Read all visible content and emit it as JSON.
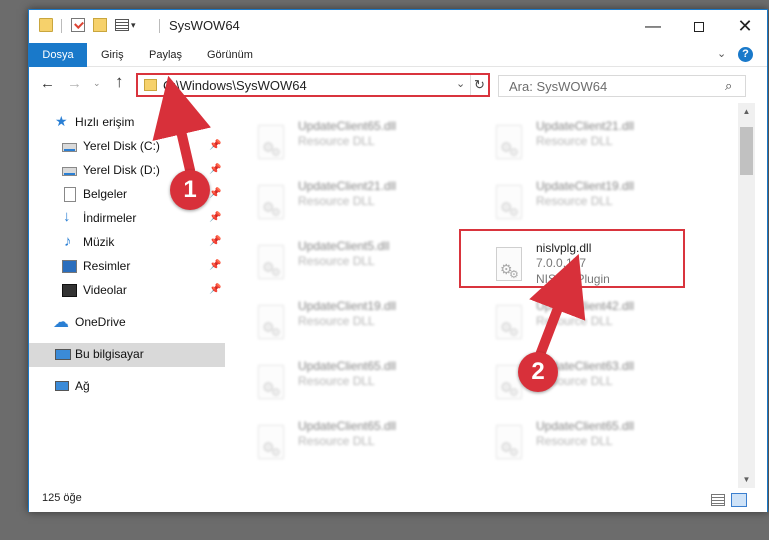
{
  "window": {
    "title": "SysWOW64",
    "minimize_glyph": "—",
    "close_glyph": "✕"
  },
  "quick_access_toolbar": {
    "dropdown_glyph": "▾",
    "pin_glyph": "▾"
  },
  "ribbon": {
    "tabs": [
      "Dosya",
      "Giriş",
      "Paylaş",
      "Görünüm"
    ],
    "collapse_glyph": "⌄",
    "help_glyph": "?"
  },
  "navigation": {
    "back_glyph": "←",
    "forward_glyph": "→",
    "recent_glyph": "⌄",
    "up_glyph": "↑",
    "address": "C:\\Windows\\SysWOW64",
    "address_dropdown_glyph": "⌄",
    "refresh_glyph": "↻",
    "search_placeholder": "Ara: SysWOW64",
    "search_glyph": "⌕"
  },
  "sidebar": {
    "items": [
      {
        "label": "Hızlı erişim",
        "icon": "star-icon",
        "glyph": "★",
        "pinned": false
      },
      {
        "label": "Yerel Disk (C:)",
        "icon": "drive-icon",
        "pinned": true
      },
      {
        "label": "Yerel Disk (D:)",
        "icon": "drive-icon",
        "pinned": true
      },
      {
        "label": "Belgeler",
        "icon": "document-icon",
        "pinned": true
      },
      {
        "label": "İndirmeler",
        "icon": "download-icon",
        "glyph": "↓",
        "pinned": true
      },
      {
        "label": "Müzik",
        "icon": "music-icon",
        "glyph": "♪",
        "pinned": true
      },
      {
        "label": "Resimler",
        "icon": "pictures-icon",
        "pinned": true
      },
      {
        "label": "Videolar",
        "icon": "videos-icon",
        "pinned": true
      },
      {
        "label": "OneDrive",
        "icon": "cloud-icon",
        "glyph": "☁",
        "pinned": false
      },
      {
        "label": "Bu bilgisayar",
        "icon": "computer-icon",
        "pinned": false,
        "selected": true
      },
      {
        "label": "Ağ",
        "icon": "network-icon",
        "pinned": false
      }
    ],
    "pin_glyph": "📌"
  },
  "files": [
    {
      "name": "UpdateClient65.dll",
      "line2": "Resource DLL",
      "line3": "",
      "blurred": true
    },
    {
      "name": "UpdateClient21.dll",
      "line2": "Resource DLL",
      "line3": "",
      "blurred": true
    },
    {
      "name": "UpdateClient21.dll",
      "line2": "Resource DLL",
      "line3": "",
      "blurred": true
    },
    {
      "name": "UpdateClient19.dll",
      "line2": "Resource DLL",
      "line3": "",
      "blurred": true
    },
    {
      "name": "UpdateClient5.dll",
      "line2": "Resource DLL",
      "line3": "",
      "blurred": true
    },
    {
      "name": "nislvplg.dll",
      "line2": "7.0.0.177",
      "line3": "NIS LV Plugin",
      "blurred": false,
      "highlighted": true
    },
    {
      "name": "UpdateClient19.dll",
      "line2": "Resource DLL",
      "line3": "",
      "blurred": true
    },
    {
      "name": "UpdateClient42.dll",
      "line2": "Resource DLL",
      "line3": "",
      "blurred": true
    },
    {
      "name": "UpdateClient65.dll",
      "line2": "Resource DLL",
      "line3": "",
      "blurred": true
    },
    {
      "name": "UpdateClient63.dll",
      "line2": "Resource DLL",
      "line3": "",
      "blurred": true
    },
    {
      "name": "UpdateClient65.dll",
      "line2": "Resource DLL",
      "line3": "",
      "blurred": true
    },
    {
      "name": "UpdateClient65.dll",
      "line2": "Resource DLL",
      "line3": "",
      "blurred": true
    }
  ],
  "file_icon": {
    "gear_glyph": "⚙"
  },
  "scrollbar": {
    "up_glyph": "▲",
    "down_glyph": "▼"
  },
  "status_bar": {
    "item_count": "125 öğe"
  },
  "annotations": {
    "step1": "1",
    "step2": "2",
    "color": "#d8303a"
  }
}
